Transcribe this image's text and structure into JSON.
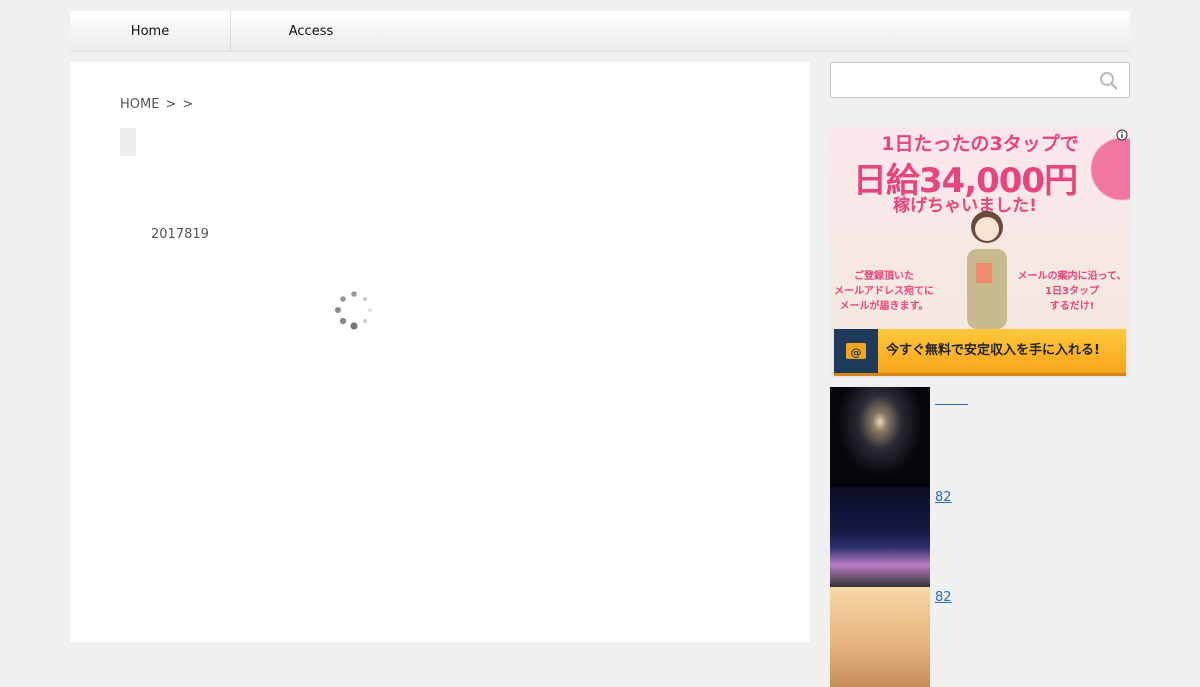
{
  "nav": {
    "items": [
      {
        "label": "Home"
      },
      {
        "label": "Access"
      }
    ]
  },
  "breadcrumb": {
    "home": "HOME",
    "sep1": ">",
    "sep2": ">"
  },
  "post": {
    "date": "2017819"
  },
  "search": {
    "placeholder": "",
    "icon": "search-icon"
  },
  "ad": {
    "headline1": "1日たったの3タップで",
    "headline2": "日給34,000円",
    "headline3": "稼げちゃいました!",
    "left_text": "ご登録頂いた\nメールアドレス宛てに\nメールが届きます。",
    "right_text": "メールの案内に沿って、\n1日3タップ\nするだけ!",
    "cta": "今すぐ無料で安定収入を手に入れる!",
    "accent": "#e8457d"
  },
  "related": {
    "items": [
      {
        "title": "",
        "thumb": "galaxy"
      },
      {
        "title": "82",
        "thumb": "tokyo-dome"
      },
      {
        "title": "82",
        "thumb": "silhouette"
      }
    ]
  }
}
